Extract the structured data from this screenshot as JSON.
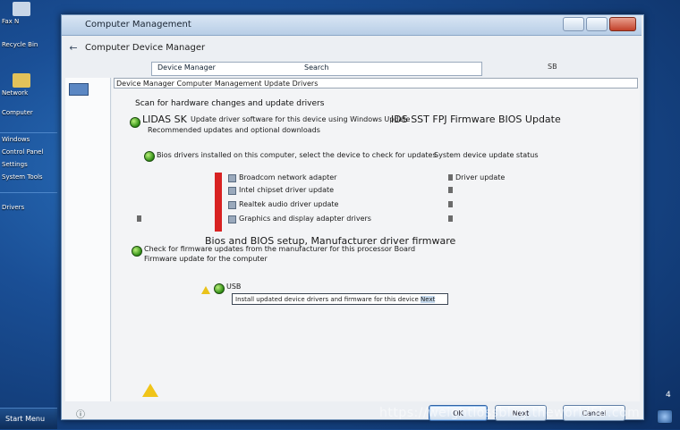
{
  "desktop": {
    "items": [
      {
        "label": "Fax N"
      },
      {
        "label": "Recycle Bin"
      },
      {
        "label": "Network"
      },
      {
        "label": "Computer"
      },
      {
        "label": "Windows"
      },
      {
        "label": "Control Panel"
      },
      {
        "label": "Settings"
      },
      {
        "label": "System Tools"
      },
      {
        "label": "Drivers"
      }
    ],
    "start_label": "Start Menu"
  },
  "window": {
    "title": "Computer Management",
    "nav_title": "Computer Device Manager",
    "address": {
      "crumb": "Device Manager",
      "search": "Search",
      "caret": "SB"
    },
    "header_line": "Device Manager Computer Management Update Drivers",
    "heading": "Scan for hardware changes and update drivers",
    "section1": {
      "title": "LIDAS SK",
      "line1": "Update driver software for this device using Windows Update",
      "line2": "Recommended updates and optional downloads",
      "right_title": "IDS SST FPJ Firmware BIOS Update"
    },
    "section2": {
      "line": "Bios drivers installed on this computer, select the device to check for updates",
      "right": "System device update status"
    },
    "list": [
      {
        "text": "Broadcom network adapter",
        "right": "Driver update"
      },
      {
        "text": "Intel chipset driver update",
        "right": ""
      },
      {
        "text": "Realtek audio driver update",
        "right": ""
      },
      {
        "text": "Graphics and display adapter drivers",
        "right": ""
      }
    ],
    "section3": {
      "title": "Bios and BIOS setup, Manufacturer driver firmware",
      "line1": "Check for firmware updates from the manufacturer for this processor Board",
      "line2": "Firmware update for the computer"
    },
    "option_label": "USB",
    "textbox": {
      "text": "Install updated device drivers and firmware for this device",
      "highlight": "Next"
    },
    "buttons": {
      "ok": "OK",
      "next": "Next",
      "cancel": "Cancel"
    }
  },
  "watermark": "https://weightlossblog.theworld5b.com",
  "tray_label": "4"
}
